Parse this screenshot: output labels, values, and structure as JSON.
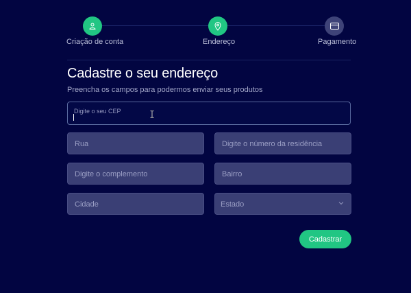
{
  "stepper": {
    "steps": [
      {
        "label": "Criação de conta",
        "icon": "user-icon",
        "state": "done"
      },
      {
        "label": "Endereço",
        "icon": "map-pin-icon",
        "state": "current"
      },
      {
        "label": "Pagamento",
        "icon": "credit-card-icon",
        "state": "todo"
      }
    ]
  },
  "heading": {
    "title": "Cadastre o seu endereço",
    "subtitle": "Preencha os campos para podermos enviar seus produtos"
  },
  "form": {
    "cep_placeholder": "Digite o seu CEP",
    "rua": "Rua",
    "numero": "Digite o número da residência",
    "complemento": "Digite o complemento",
    "bairro": "Bairro",
    "cidade": "Cidade",
    "estado": "Estado",
    "submit": "Cadastrar"
  },
  "colors": {
    "background": "#020541",
    "accent": "#21c683",
    "field_bg": "#3a3f75",
    "step_todo": "#3e4378"
  }
}
